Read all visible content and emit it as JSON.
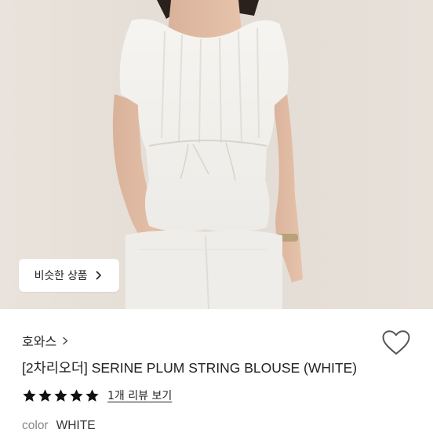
{
  "similar_button": {
    "label": "비슷한 상품",
    "icon": "chevron-right-icon"
  },
  "product": {
    "brand": "호와스",
    "brand_icon": "chevron-right-icon",
    "title": "[2차리오더] SERINE PLUM STRING BLOUSE (WHITE)",
    "rating": 5,
    "rating_max": 5,
    "review_link": "1개 리뷰 보기",
    "color_label": "color",
    "color_value": "WHITE",
    "wishlist_icon": "heart-outline-icon"
  },
  "colors": {
    "text": "#222222",
    "muted": "#888888",
    "star": "#111111",
    "photo_bg": "#e6dfd7"
  }
}
